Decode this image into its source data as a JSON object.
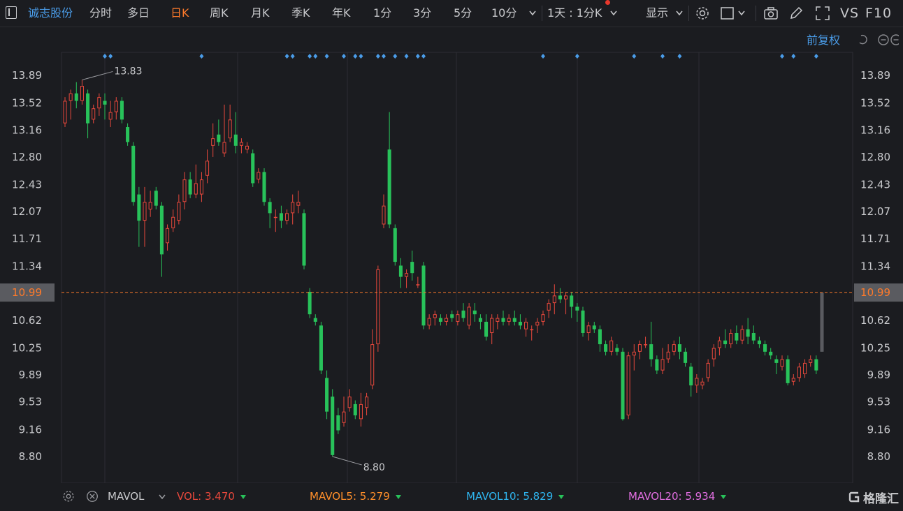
{
  "toolbar": {
    "stock_name": "诚志股份",
    "periods": [
      "分时",
      "多日",
      "日K",
      "周K",
      "月K",
      "季K",
      "年K",
      "1分",
      "3分",
      "5分",
      "10分"
    ],
    "active_period": "日K",
    "multi_period_label": "1天 : 1分K",
    "display_label": "显示",
    "vs_label": "VS",
    "f10_label": "F10"
  },
  "adjust_label": "前复权",
  "price_axis": {
    "ticks": [
      "13.89",
      "13.52",
      "13.16",
      "12.80",
      "12.43",
      "12.07",
      "11.71",
      "11.34",
      "10.99",
      "10.62",
      "10.25",
      "9.89",
      "9.53",
      "9.16",
      "8.80"
    ],
    "current_price": "10.99"
  },
  "annotations": {
    "high": "13.83",
    "low": "8.80"
  },
  "colors": {
    "up": "#e8483c",
    "down": "#28c25a",
    "accent": "#ff7a2a",
    "blue": "#4a9ce8"
  },
  "indicators": {
    "name": "MAVOL",
    "vol_label": "VOL:",
    "vol_value": "3.470",
    "ma5_label": "MAVOL5:",
    "ma5_value": "5.279",
    "ma10_label": "MAVOL10:",
    "ma10_value": "5.829",
    "ma20_label": "MAVOL20:",
    "ma20_value": "5.934"
  },
  "brand": "格隆汇",
  "chart_data": {
    "type": "candlestick",
    "ylim": [
      8.8,
      13.89
    ],
    "candles": [
      [
        13.25,
        13.55,
        13.6,
        13.2
      ],
      [
        13.55,
        13.65,
        13.7,
        13.3
      ],
      [
        13.65,
        13.55,
        13.8,
        13.45
      ],
      [
        13.55,
        13.75,
        13.83,
        13.5
      ],
      [
        13.65,
        13.25,
        13.7,
        13.05
      ],
      [
        13.3,
        13.45,
        13.5,
        13.25
      ],
      [
        13.45,
        13.6,
        13.65,
        13.35
      ],
      [
        13.55,
        13.5,
        13.65,
        13.3
      ],
      [
        13.3,
        13.4,
        13.55,
        13.2
      ],
      [
        13.4,
        13.55,
        13.6,
        13.3
      ],
      [
        13.55,
        13.3,
        13.6,
        13.25
      ],
      [
        13.2,
        13.0,
        13.25,
        12.95
      ],
      [
        12.95,
        12.2,
        13.0,
        12.15
      ],
      [
        12.3,
        11.95,
        12.4,
        11.6
      ],
      [
        11.95,
        12.2,
        12.4,
        11.6
      ],
      [
        12.1,
        12.2,
        12.35,
        12.0
      ],
      [
        12.35,
        12.15,
        12.4,
        12.1
      ],
      [
        12.15,
        11.5,
        12.2,
        11.2
      ],
      [
        11.65,
        11.85,
        11.9,
        11.55
      ],
      [
        11.85,
        12.0,
        12.1,
        11.8
      ],
      [
        11.95,
        12.2,
        12.3,
        11.9
      ],
      [
        12.2,
        12.5,
        12.6,
        12.1
      ],
      [
        12.5,
        12.3,
        12.6,
        12.25
      ],
      [
        12.3,
        12.45,
        12.7,
        12.25
      ],
      [
        12.3,
        12.5,
        12.6,
        12.2
      ],
      [
        12.55,
        12.75,
        12.9,
        12.45
      ],
      [
        12.95,
        13.05,
        13.25,
        12.8
      ],
      [
        13.1,
        13.0,
        13.3,
        12.95
      ],
      [
        12.85,
        13.0,
        13.5,
        12.8
      ],
      [
        13.05,
        13.3,
        13.5,
        13.0
      ],
      [
        13.1,
        12.95,
        13.4,
        12.85
      ],
      [
        12.95,
        13.0,
        13.05,
        12.85
      ],
      [
        12.9,
        12.95,
        13.0,
        12.85
      ],
      [
        12.85,
        12.45,
        12.9,
        12.4
      ],
      [
        12.5,
        12.6,
        12.65,
        12.45
      ],
      [
        12.6,
        12.2,
        12.65,
        12.15
      ],
      [
        12.2,
        12.05,
        12.25,
        11.85
      ],
      [
        12.0,
        12.0,
        12.1,
        11.8
      ],
      [
        12.05,
        11.95,
        12.15,
        11.85
      ],
      [
        11.95,
        12.05,
        12.1,
        11.9
      ],
      [
        12.05,
        12.2,
        12.3,
        11.9
      ],
      [
        12.15,
        12.2,
        12.35,
        12.05
      ],
      [
        12.05,
        11.35,
        12.1,
        11.3
      ],
      [
        11.0,
        10.7,
        11.05,
        10.65
      ],
      [
        10.65,
        10.6,
        10.7,
        10.55
      ],
      [
        10.55,
        9.95,
        10.6,
        9.9
      ],
      [
        9.85,
        9.4,
        9.95,
        9.3
      ],
      [
        9.6,
        8.82,
        9.7,
        8.8
      ],
      [
        9.35,
        9.15,
        9.45,
        9.1
      ],
      [
        9.25,
        9.4,
        9.6,
        9.2
      ],
      [
        9.45,
        9.6,
        9.7,
        9.4
      ],
      [
        9.5,
        9.35,
        9.55,
        9.3
      ],
      [
        9.3,
        9.5,
        9.65,
        9.2
      ],
      [
        9.45,
        9.6,
        9.65,
        9.35
      ],
      [
        9.75,
        10.3,
        10.5,
        9.7
      ],
      [
        10.3,
        11.3,
        11.35,
        10.2
      ],
      [
        11.9,
        12.15,
        12.3,
        11.85
      ],
      [
        12.9,
        11.9,
        13.4,
        11.85
      ],
      [
        11.85,
        11.4,
        11.9,
        11.35
      ],
      [
        11.35,
        11.2,
        11.45,
        11.05
      ],
      [
        11.2,
        11.25,
        11.3,
        11.05
      ],
      [
        11.4,
        11.25,
        11.55,
        11.15
      ],
      [
        11.1,
        11.1,
        11.2,
        11.05
      ],
      [
        11.35,
        10.55,
        11.4,
        10.5
      ],
      [
        10.55,
        10.65,
        10.7,
        10.5
      ],
      [
        10.65,
        10.7,
        10.75,
        10.55
      ],
      [
        10.65,
        10.6,
        10.7,
        10.55
      ],
      [
        10.6,
        10.65,
        10.7,
        10.55
      ],
      [
        10.7,
        10.65,
        10.75,
        10.6
      ],
      [
        10.6,
        10.7,
        10.75,
        10.55
      ],
      [
        10.75,
        10.65,
        10.85,
        10.6
      ],
      [
        10.55,
        10.8,
        10.85,
        10.5
      ],
      [
        10.75,
        10.7,
        10.85,
        10.6
      ],
      [
        10.65,
        10.6,
        10.7,
        10.5
      ],
      [
        10.6,
        10.4,
        10.7,
        10.35
      ],
      [
        10.45,
        10.65,
        10.7,
        10.3
      ],
      [
        10.6,
        10.65,
        10.7,
        10.5
      ],
      [
        10.65,
        10.6,
        10.75,
        10.55
      ],
      [
        10.6,
        10.65,
        10.7,
        10.55
      ],
      [
        10.65,
        10.6,
        10.75,
        10.55
      ],
      [
        10.6,
        10.55,
        10.7,
        10.5
      ],
      [
        10.5,
        10.6,
        10.65,
        10.4
      ],
      [
        10.5,
        10.5,
        10.55,
        10.35
      ],
      [
        10.55,
        10.6,
        10.65,
        10.45
      ],
      [
        10.6,
        10.7,
        10.75,
        10.55
      ],
      [
        10.75,
        10.85,
        10.9,
        10.65
      ],
      [
        10.85,
        10.95,
        11.1,
        10.7
      ],
      [
        10.95,
        10.9,
        11.05,
        10.85
      ],
      [
        10.9,
        10.95,
        11.0,
        10.7
      ],
      [
        10.95,
        10.8,
        11.0,
        10.65
      ],
      [
        10.8,
        10.75,
        10.85,
        10.6
      ],
      [
        10.75,
        10.45,
        10.8,
        10.4
      ],
      [
        10.45,
        10.55,
        10.6,
        10.35
      ],
      [
        10.55,
        10.5,
        10.6,
        10.45
      ],
      [
        10.5,
        10.3,
        10.55,
        10.2
      ],
      [
        10.3,
        10.2,
        10.35,
        10.15
      ],
      [
        10.2,
        10.35,
        10.4,
        10.15
      ],
      [
        10.25,
        10.2,
        10.3,
        10.15
      ],
      [
        10.2,
        9.3,
        10.25,
        9.28
      ],
      [
        9.35,
        10.15,
        10.2,
        9.3
      ],
      [
        10.15,
        10.2,
        10.3,
        9.95
      ],
      [
        10.2,
        10.3,
        10.35,
        10.1
      ],
      [
        10.3,
        10.3,
        10.4,
        10.25
      ],
      [
        10.3,
        10.1,
        10.6,
        10.0
      ],
      [
        10.1,
        9.95,
        10.15,
        9.9
      ],
      [
        9.95,
        10.1,
        10.25,
        9.9
      ],
      [
        10.1,
        10.2,
        10.3,
        10.05
      ],
      [
        10.2,
        10.3,
        10.35,
        10.15
      ],
      [
        10.3,
        10.2,
        10.4,
        10.1
      ],
      [
        10.2,
        10.05,
        10.25,
        10.0
      ],
      [
        10.0,
        9.75,
        10.05,
        9.6
      ],
      [
        9.75,
        9.85,
        9.9,
        9.65
      ],
      [
        9.75,
        9.8,
        9.85,
        9.7
      ],
      [
        9.85,
        10.05,
        10.1,
        9.8
      ],
      [
        10.1,
        10.25,
        10.3,
        10.0
      ],
      [
        10.25,
        10.35,
        10.4,
        10.15
      ],
      [
        10.35,
        10.3,
        10.5,
        10.25
      ],
      [
        10.3,
        10.45,
        10.5,
        10.25
      ],
      [
        10.45,
        10.35,
        10.55,
        10.3
      ],
      [
        10.35,
        10.5,
        10.55,
        10.3
      ],
      [
        10.5,
        10.4,
        10.65,
        10.3
      ],
      [
        10.45,
        10.35,
        10.55,
        10.3
      ],
      [
        10.35,
        10.3,
        10.4,
        10.25
      ],
      [
        10.3,
        10.2,
        10.35,
        10.15
      ],
      [
        10.2,
        10.15,
        10.25,
        10.1
      ],
      [
        10.1,
        10.05,
        10.15,
        9.9
      ],
      [
        10.0,
        10.1,
        10.15,
        9.95
      ],
      [
        10.1,
        9.78,
        10.15,
        9.75
      ],
      [
        9.8,
        9.85,
        9.9,
        9.75
      ],
      [
        9.85,
        10.0,
        10.05,
        9.8
      ],
      [
        9.9,
        10.05,
        10.1,
        9.85
      ],
      [
        10.05,
        10.1,
        10.15,
        10.0
      ],
      [
        10.1,
        9.95,
        10.15,
        9.9
      ],
      [
        10.2,
        10.99,
        10.99,
        10.2
      ]
    ]
  }
}
